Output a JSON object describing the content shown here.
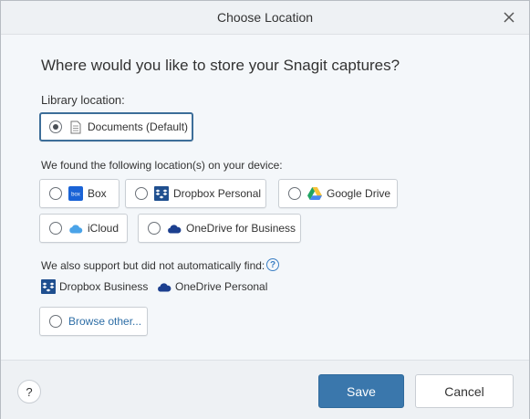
{
  "window": {
    "title": "Choose Location"
  },
  "main": {
    "question": "Where would you like to store your Snagit captures?",
    "library_label": "Library location:",
    "library_option": {
      "label": "Documents (Default)",
      "selected": true,
      "icon": "document-icon"
    },
    "found_label": "We found the following location(s) on your device:",
    "found_options": [
      {
        "label": "Box",
        "icon": "box-icon"
      },
      {
        "label": "Dropbox Personal",
        "icon": "dropbox-icon"
      },
      {
        "label": "Google Drive",
        "icon": "google-drive-icon"
      },
      {
        "label": "iCloud",
        "icon": "icloud-icon"
      },
      {
        "label": "OneDrive for Business",
        "icon": "onedrive-icon"
      }
    ],
    "support_label": "We also support but did not automatically find:",
    "supported": [
      {
        "label": "Dropbox Business",
        "icon": "dropbox-icon"
      },
      {
        "label": "OneDrive Personal",
        "icon": "onedrive-icon"
      }
    ],
    "browse_label": "Browse other..."
  },
  "footer": {
    "help": "?",
    "save": "Save",
    "cancel": "Cancel"
  },
  "colors": {
    "accent": "#3a77ac",
    "link": "#2e6ea6",
    "selected_border": "#3d6e99"
  }
}
